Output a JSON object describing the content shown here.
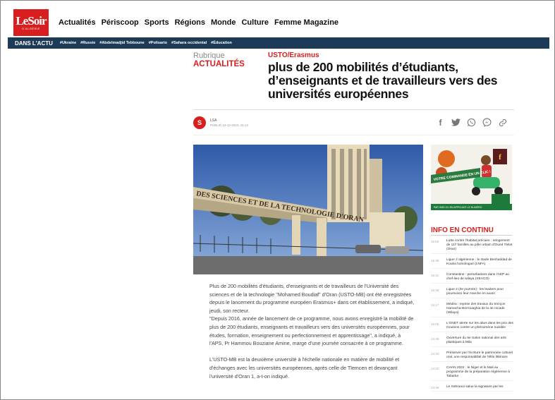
{
  "header": {
    "logo_main": "LeSoir",
    "logo_sub": "D'ALGÉRIE",
    "nav": [
      "Actualités",
      "Périscoop",
      "Sports",
      "Régions",
      "Monde",
      "Culture",
      "Femme Magazine"
    ]
  },
  "actu": {
    "label": "DANS L'ACTU",
    "tags": [
      "#Ukraine",
      "#Russie",
      "#Abdelmadjid Tebboune",
      "#Polisario",
      "#Sahara occidental",
      "#Éducation"
    ]
  },
  "article": {
    "rubrique_label": "Rubrique",
    "rubrique_name": "ACTUALITÉS",
    "kicker": "USTO/Erasmus",
    "title": "plus de 200 mobilités d’étudiants, d’enseignants et de travailleurs vers des universités européennes",
    "author_initial": "S",
    "author_name": "LSA",
    "published": "PUBLIÉ 13-10-2023, 15:13",
    "paragraphs": [
      "Plus de 200 mobilités d'étudiants, d'enseignants et de travailleurs de l'Université des sciences et de la technologie \"Mohamed Boudiaf\" d'Oran (USTO-MB) ont été enregistrées depuis le lancement du programme européen Erasmus+ dans cet établissement, a indiqué, jeudi, son recteur.",
      "\"Depuis 2016, année de lancement de ce programme, nous avons enregistré la mobilité de plus de 200 étudiants, enseignants et travailleurs vers des universités européennes, pour études, formation, enseignement ou perfectionnement et apprentissage\", a indiqué, à l'APS, Pr Hammou Bouziane Amine, marge d'une journée consacrée à ce programme.",
      "L'USTO-MB est la deuxième université à l'échelle nationale en matière de mobilité et d'échanges avec les universités européennes, après celle de Tlemcen et devançant l'université d'Oran 1, a-t-on indiqué."
    ],
    "photo_banner": "DES SCIENCES ET DE LA TECHNOLOGIE D'ORAN"
  },
  "share_icons": [
    "facebook-icon",
    "twitter-icon",
    "whatsapp-icon",
    "messenger-icon",
    "link-icon"
  ],
  "ad": {
    "headline": "VOTRE COMMANDE EN UN CLIC !",
    "footer": "PAR SMS OU EN APPELANT LE NUMÉRO"
  },
  "info": {
    "title": "INFO EN CONTINU",
    "items": [
      {
        "time": "15:59",
        "text": "Lutte contre l'habitat précaire : relogement de 117 familles au pôle urbain d'Oued Tlelat (Oran)"
      },
      {
        "time": "15:36",
        "text": "Ligue 2 algérienne : le stade Benhaddad de Kouba homologué (LNFA)"
      },
      {
        "time": "15:31",
        "text": "Constantine : perturbations dans l'AEP au chef-lieu de wilaya (SEACO)"
      },
      {
        "time": "15:28",
        "text": "Ligue 2 (3e journée) : les leaders pour poursuivre leur marche en avant"
      },
      {
        "time": "15:17",
        "text": "Médéa : reprise des travaux du tronçon Hamacha-Berrouaghia de la 4e rocade (Wilaya)"
      },
      {
        "time": "15:05",
        "text": "L'ONDT alerte sur les abus dans les prix des moutons contre un phénomène nuisible"
      },
      {
        "time": "14:48",
        "text": "Ouverture du 6e Salon national des arts plastiques à Mila"
      },
      {
        "time": "14:33",
        "text": "Préserver par l'écriture le patrimoine culturel oral, une responsabilité de l'élite littéraire"
      },
      {
        "time": "14:02",
        "text": "CHAN 2022 : le Niger et le Mali au programme de la préparation Algérienne à Tabarka"
      },
      {
        "time": "13:49",
        "text": "Le Sahraoui salue la signature par les"
      }
    ]
  },
  "colors": {
    "brand_red": "#d81e1e",
    "actu_bar": "#1d3b57"
  }
}
